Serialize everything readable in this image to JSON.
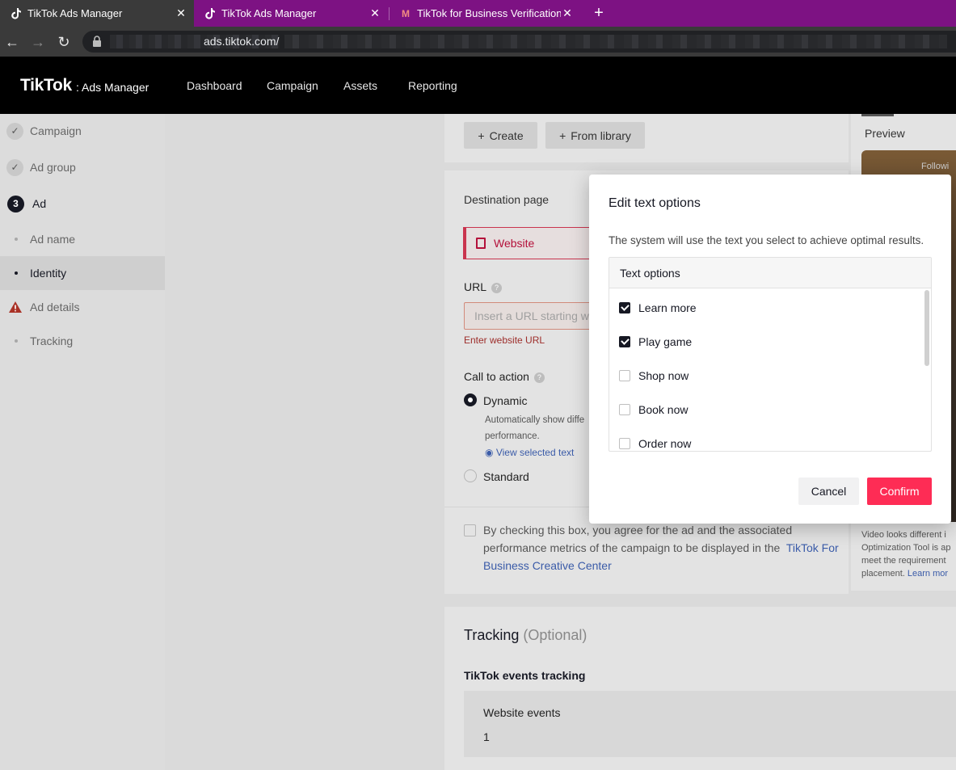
{
  "browser": {
    "tabs": [
      {
        "title": "TikTok Ads Manager",
        "active": true
      },
      {
        "title": "TikTok Ads Manager",
        "active": false
      },
      {
        "title": "TikTok for Business Verification C",
        "active": false
      }
    ],
    "url": "ads.tiktok.com/"
  },
  "header": {
    "logo": "TikTok",
    "logo_sub": "Ads Manager",
    "nav": [
      "Dashboard",
      "Campaign",
      "Assets",
      "Reporting"
    ]
  },
  "sidebar": {
    "steps": [
      {
        "label": "Campaign",
        "state": "done"
      },
      {
        "label": "Ad group",
        "state": "done"
      },
      {
        "label": "Ad",
        "state": "current",
        "number": "3"
      }
    ],
    "sub_items": [
      {
        "label": "Ad name",
        "state": "normal"
      },
      {
        "label": "Identity",
        "state": "selected"
      },
      {
        "label": "Ad details",
        "state": "warning"
      },
      {
        "label": "Tracking",
        "state": "normal"
      }
    ]
  },
  "main": {
    "create_label": "Create",
    "library_label": "From library",
    "destination_label": "Destination page",
    "destination_value": "Website",
    "url_label": "URL",
    "url_placeholder": "Insert a URL starting wi",
    "url_error": "Enter website URL",
    "cta_label": "Call to action",
    "cta_dynamic": "Dynamic",
    "cta_dynamic_desc_1": "Automatically show diffe",
    "cta_dynamic_desc_2": "performance.",
    "view_selected": "View selected text",
    "cta_standard": "Standard",
    "agree_text_1": "By checking this box, you agree for the ad and the associated",
    "agree_text_2": "performance metrics of the campaign to be displayed in the",
    "agree_link": "TikTok For Business Creative Center",
    "tracking_title": "Tracking",
    "tracking_optional": "(Optional)",
    "events_label": "TikTok events tracking",
    "website_events_label": "Website events",
    "website_events_value": "1"
  },
  "preview": {
    "label": "Preview",
    "follow": "Followi",
    "note_lines": [
      "Video looks different i",
      "Optimization Tool is ap",
      "meet the requirement",
      "placement."
    ],
    "note_link": "Learn mor"
  },
  "modal": {
    "title": "Edit text options",
    "description": "The system will use the text you select to achieve optimal results.",
    "list_header": "Text options",
    "options": [
      {
        "label": "Learn more",
        "checked": true
      },
      {
        "label": "Play game",
        "checked": true
      },
      {
        "label": "Shop now",
        "checked": false
      },
      {
        "label": "Book now",
        "checked": false
      },
      {
        "label": "Order now",
        "checked": false
      }
    ],
    "cancel_label": "Cancel",
    "confirm_label": "Confirm"
  },
  "colors": {
    "tabbar": "#7d1283",
    "confirm": "#fe2c55",
    "error": "#9d2d2a",
    "destination": "#b4103a"
  }
}
